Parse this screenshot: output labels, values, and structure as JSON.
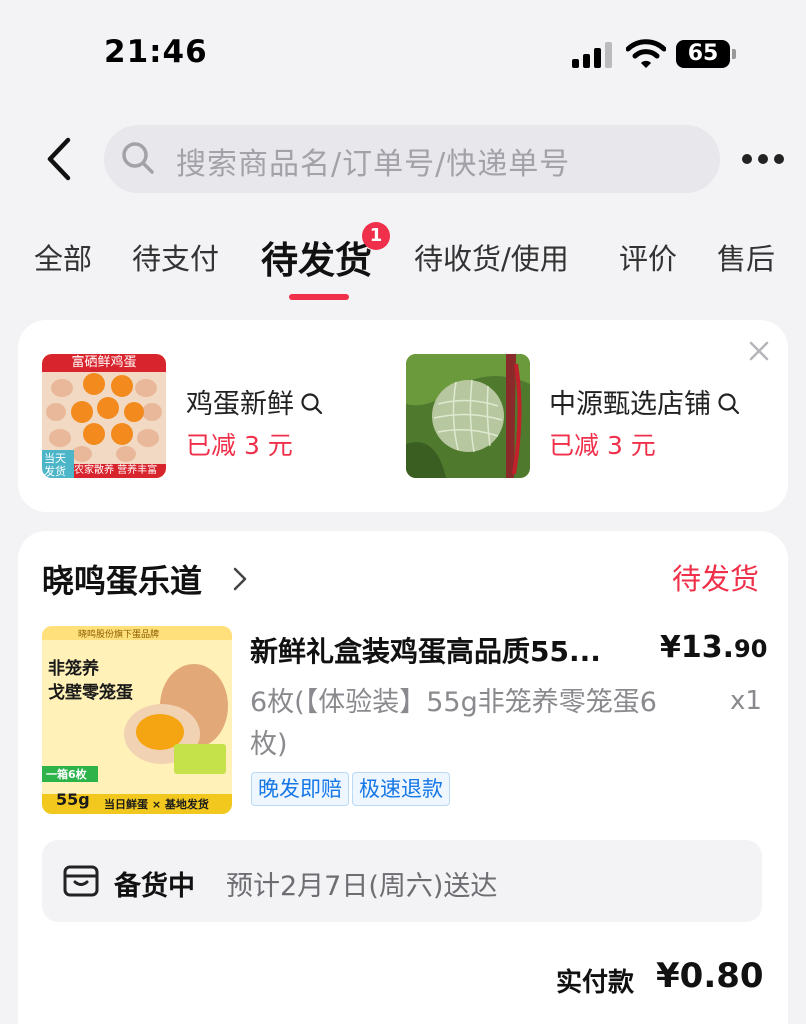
{
  "status_bar": {
    "time": "21:46",
    "battery": "65"
  },
  "search": {
    "placeholder": "搜索商品名/订单号/快递单号"
  },
  "tabs": [
    {
      "label": "全部"
    },
    {
      "label": "待支付"
    },
    {
      "label": "待发货",
      "badge": "1"
    },
    {
      "label": "待收货/使用"
    },
    {
      "label": "评价"
    },
    {
      "label": "售后"
    }
  ],
  "recommend": {
    "items": [
      {
        "name": "鸡蛋新鲜",
        "discount": "已减 3 元",
        "img_banner": "富硒鲜鸡蛋",
        "img_tag": "当天发货",
        "img_footer": "农家散养 营养丰富"
      },
      {
        "name": "中源甄选店铺",
        "discount": "已减 3 元"
      }
    ]
  },
  "order": {
    "shop_name": "晓鸣蛋乐道",
    "status": "待发货",
    "product": {
      "title": "新鲜礼盒装鸡蛋高品质55...",
      "price_main": "¥13.",
      "price_decimal": "90",
      "spec": "6枚(【体验装】55g非笼养零笼蛋6枚)",
      "qty": "x1",
      "tags": [
        "晚发即赔",
        "极速退款"
      ],
      "img_brand": "晓鸣股份旗下蛋品牌",
      "img_line1": "非笼养",
      "img_line2": "戈壁零笼蛋",
      "img_box": "一箱6枚",
      "img_weight": "55g",
      "img_footer": "当日鲜蛋 × 基地发货"
    },
    "shipping": {
      "label": "备货中",
      "eta": "预计2月7日(周六)送达"
    },
    "payment": {
      "label": "实付款",
      "amount": "¥0.80"
    }
  },
  "colors": {
    "accent": "#f0304a",
    "tag_blue": "#1677e6"
  }
}
